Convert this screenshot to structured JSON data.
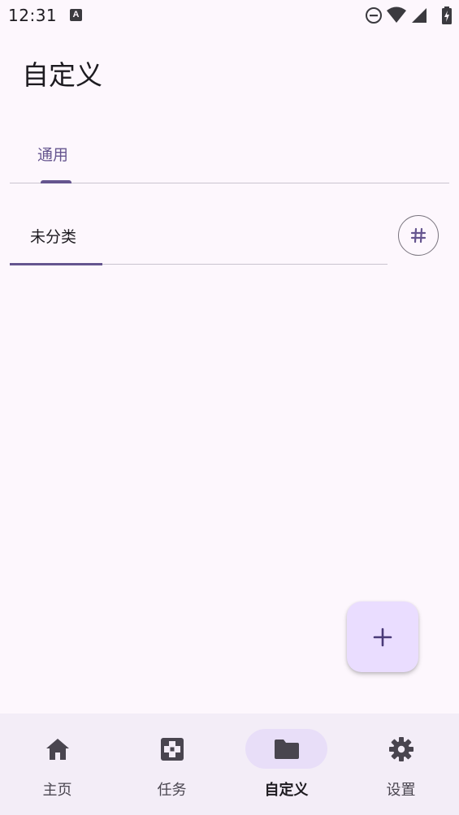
{
  "status_bar": {
    "time": "12:31",
    "notification_badge": "A",
    "icons": [
      "do-not-disturb-icon",
      "wifi-icon",
      "signal-icon",
      "battery-charging-icon"
    ]
  },
  "page": {
    "title": "自定义"
  },
  "tabs": [
    {
      "label": "通用",
      "selected": true
    }
  ],
  "category_tabs": [
    {
      "label": "未分类",
      "selected": true
    }
  ],
  "tag_button": {
    "icon": "hashtag-icon"
  },
  "fab": {
    "icon": "plus-icon"
  },
  "bottom_nav": {
    "items": [
      {
        "label": "主页",
        "icon": "home-icon",
        "active": false
      },
      {
        "label": "任务",
        "icon": "task-icon",
        "active": false
      },
      {
        "label": "自定义",
        "icon": "folder-icon",
        "active": true
      },
      {
        "label": "设置",
        "icon": "gear-icon",
        "active": false
      }
    ]
  },
  "colors": {
    "background": "#fdf7fd",
    "primary": "#65558f",
    "fab": "#eaddff",
    "nav_background": "#f3edf7",
    "nav_active_pill": "#e8def8"
  }
}
